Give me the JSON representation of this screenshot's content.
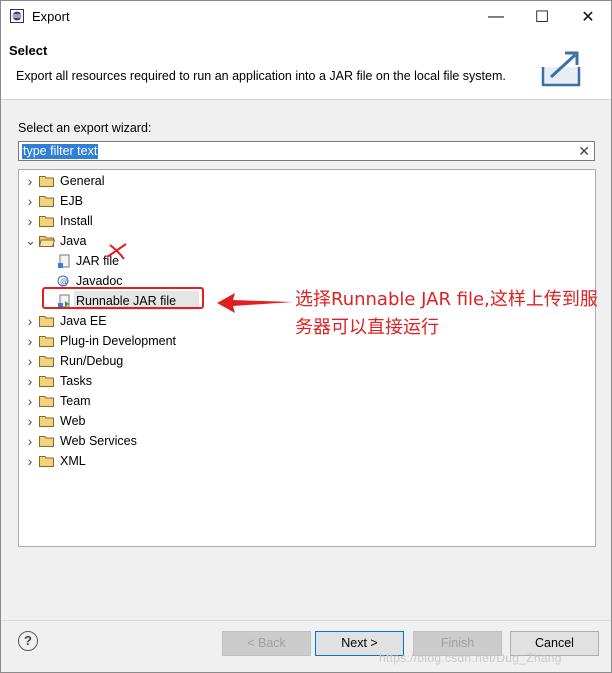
{
  "window": {
    "title": "Export",
    "controls": {
      "minimize": "—",
      "maximize": "☐",
      "close": "✕"
    }
  },
  "header": {
    "title": "Select",
    "description": "Export all resources required to run an application into a JAR file on the local file system."
  },
  "wizard": {
    "label": "Select an export wizard:",
    "filter_value": "type filter text",
    "clear_glyph": "✕"
  },
  "tree": [
    {
      "label": "General",
      "expanded": false
    },
    {
      "label": "EJB",
      "expanded": false
    },
    {
      "label": "Install",
      "expanded": false
    },
    {
      "label": "Java",
      "expanded": true,
      "children": [
        {
          "label": "JAR file",
          "icon": "jar-file-icon"
        },
        {
          "label": "Javadoc",
          "icon": "javadoc-icon"
        },
        {
          "label": "Runnable JAR file",
          "icon": "runnable-jar-icon",
          "selected": true
        }
      ]
    },
    {
      "label": "Java EE",
      "expanded": false
    },
    {
      "label": "Plug-in Development",
      "expanded": false
    },
    {
      "label": "Run/Debug",
      "expanded": false
    },
    {
      "label": "Tasks",
      "expanded": false
    },
    {
      "label": "Team",
      "expanded": false
    },
    {
      "label": "Web",
      "expanded": false
    },
    {
      "label": "Web Services",
      "expanded": false
    },
    {
      "label": "XML",
      "expanded": false
    }
  ],
  "annotation": {
    "text": "选择Runnable JAR file,这样上传到服务器可以直接运行",
    "color": "#e02020"
  },
  "buttons": {
    "help": "?",
    "back": "< Back",
    "next": "Next >",
    "finish": "Finish",
    "cancel": "Cancel"
  },
  "watermark": "https://blog.csdn.net/Dug_Zhang"
}
